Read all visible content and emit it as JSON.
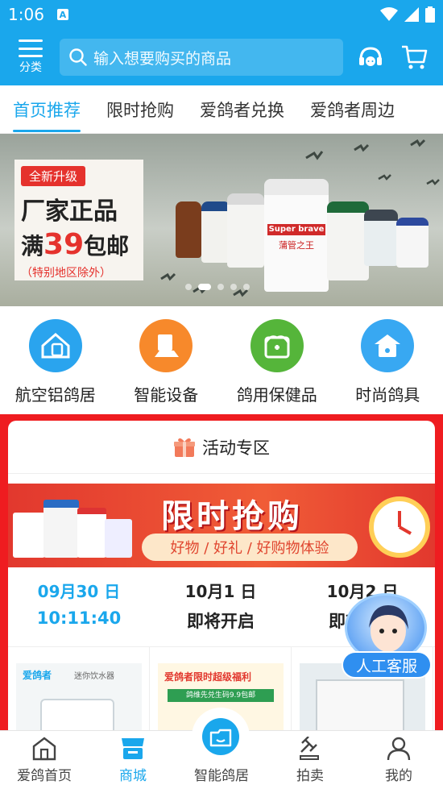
{
  "status_bar": {
    "time": "1:06",
    "notification_icon": "A"
  },
  "header": {
    "menu_label": "分类",
    "search_placeholder": "输入想要购买的商品",
    "icons": [
      "customer-service-icon",
      "cart-icon"
    ]
  },
  "tabs": [
    {
      "label": "首页推荐",
      "active": true
    },
    {
      "label": "限时抢购",
      "active": false
    },
    {
      "label": "爱鸽者兑换",
      "active": false
    },
    {
      "label": "爱鸽者周边",
      "active": false
    }
  ],
  "banner": {
    "tag": "全新升级",
    "line1": "厂家正品",
    "line2_prefix": "满",
    "line2_number": "39",
    "line2_suffix": "包邮",
    "note": "（特别地区除外）",
    "product_text": "Super brave",
    "product_text_cn": "蒲管之王",
    "slide_count": 5,
    "active_slide": 1
  },
  "categories": [
    {
      "label": "航空铝鸽居",
      "icon": "house-icon",
      "color": "#2aa4ee"
    },
    {
      "label": "智能设备",
      "icon": "feeder-icon",
      "color": "#f7892b"
    },
    {
      "label": "鸽用保健品",
      "icon": "medicine-icon",
      "color": "#55b53a"
    },
    {
      "label": "时尚鸽具",
      "icon": "loft-icon",
      "color": "#38a8f2"
    }
  ],
  "activity": {
    "title": "活动专区",
    "flash_title": "限时抢购",
    "flash_subtitle": "好物 / 好礼 / 好购物体验",
    "sessions": [
      {
        "date": "09月30 日",
        "status": "10:11:40",
        "current": true
      },
      {
        "date": "10月1 日",
        "status": "即将开启",
        "current": false
      },
      {
        "date": "10月2 日",
        "status": "即将开启",
        "current": false
      }
    ],
    "products": [
      {
        "brand": "爱鸽者",
        "caption": "迷你饮水器"
      },
      {
        "brand": "爱鸽者限时超级福利",
        "caption": "鸽维先兑生码9.9包邮"
      },
      {
        "brand": "",
        "caption": ""
      }
    ]
  },
  "customer_service": {
    "label": "人工客服"
  },
  "bottom_nav": [
    {
      "label": "爱鸽首页",
      "icon": "home-icon",
      "active": false
    },
    {
      "label": "商城",
      "icon": "store-icon",
      "active": true
    },
    {
      "label": "智能鸽居",
      "icon": "smart-loft-icon",
      "active": false
    },
    {
      "label": "拍卖",
      "icon": "auction-icon",
      "active": false
    },
    {
      "label": "我的",
      "icon": "profile-icon",
      "active": false
    }
  ]
}
